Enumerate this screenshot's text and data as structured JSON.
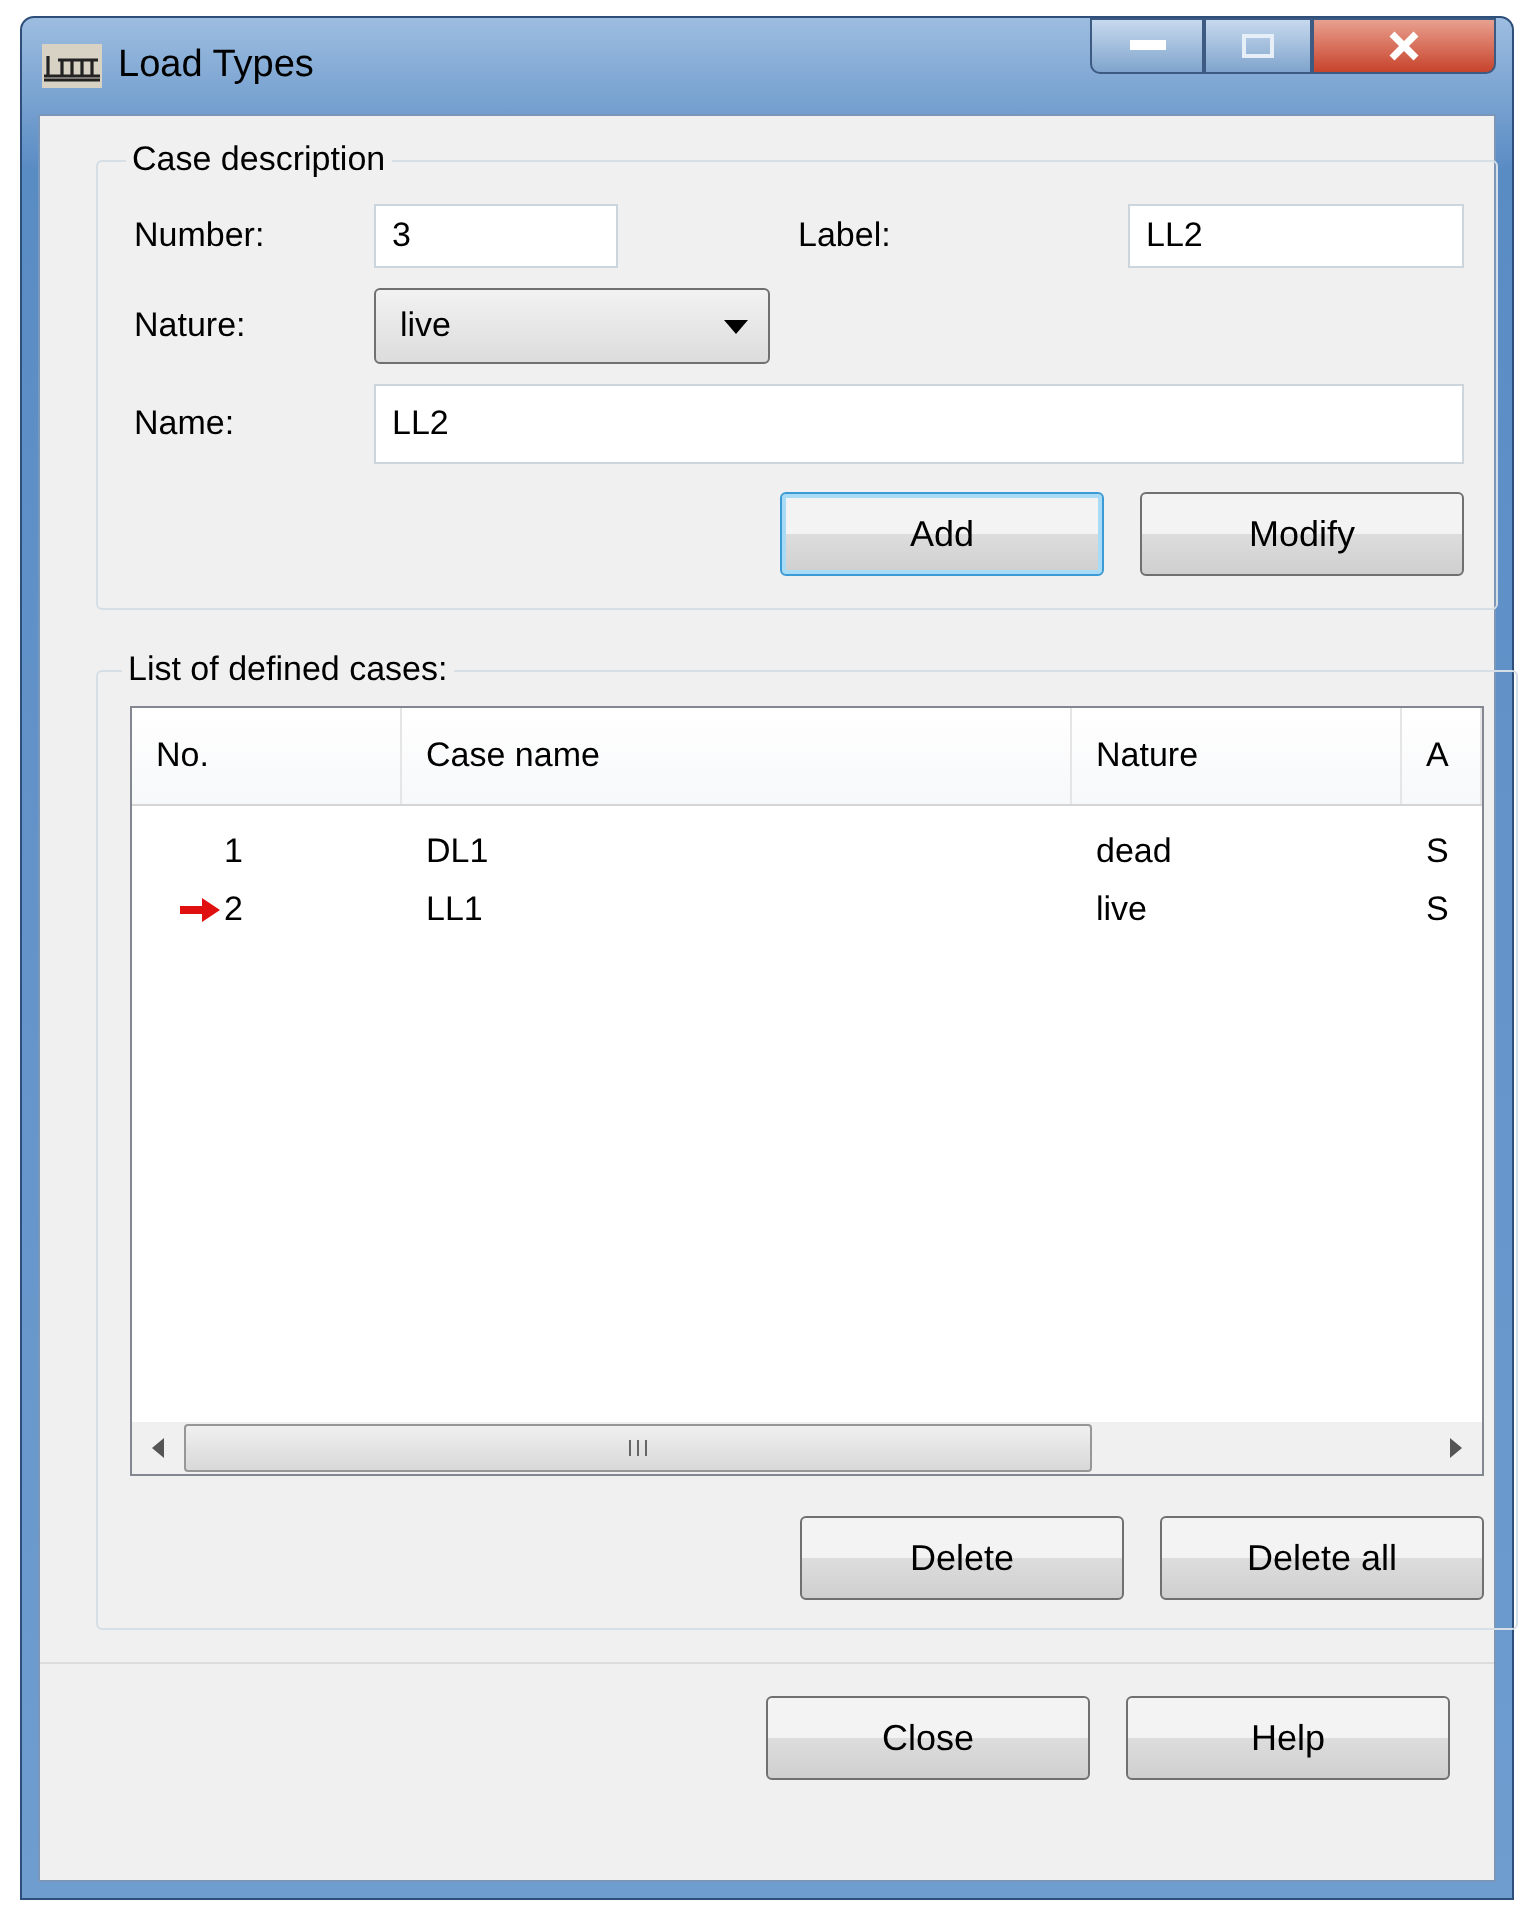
{
  "window": {
    "title": "Load Types"
  },
  "case_description": {
    "title": "Case description",
    "number": {
      "label": "Number:",
      "value": "3"
    },
    "label": {
      "label": "Label:",
      "value": "LL2"
    },
    "nature": {
      "label": "Nature:",
      "value": "live"
    },
    "name": {
      "label": "Name:",
      "value": "LL2"
    },
    "buttons": [
      {
        "label": "Add",
        "default": true
      },
      {
        "label": "Modify",
        "default": false
      }
    ]
  },
  "cases": {
    "title": "List of defined cases:",
    "columns": [
      "No.",
      "Case name",
      "Nature",
      "A"
    ],
    "rows": [
      {
        "cells": [
          "1",
          "DL1",
          "dead",
          "S"
        ],
        "current": false
      },
      {
        "cells": [
          "2",
          "LL1",
          "live",
          "S"
        ],
        "current": true
      }
    ],
    "buttons": [
      "Delete",
      "Delete all"
    ]
  },
  "buttons": [
    "Close",
    "Help"
  ]
}
